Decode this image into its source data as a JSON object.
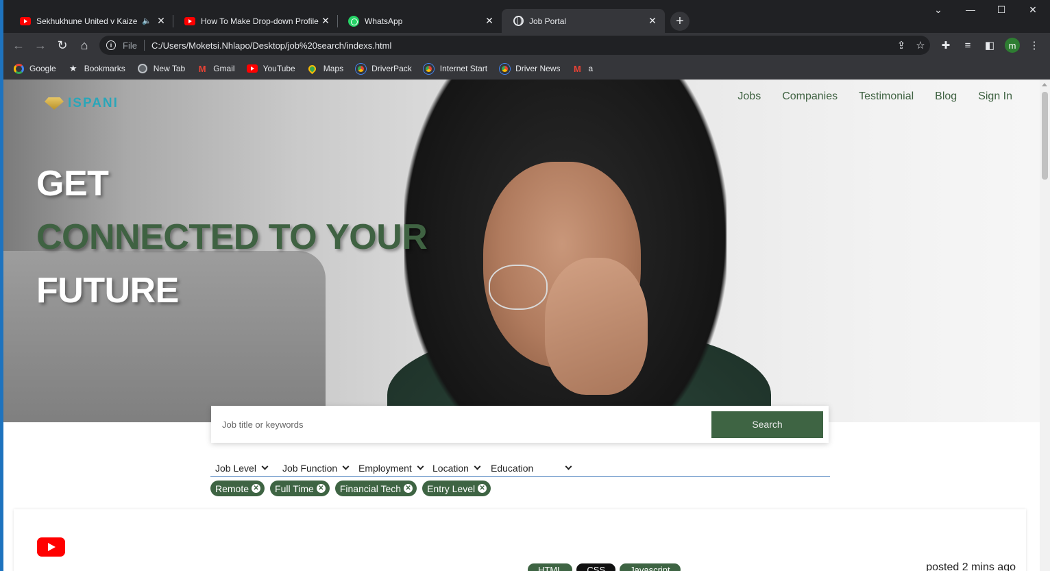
{
  "browser": {
    "tabs": [
      {
        "title": "Sekhukhune United v Kaizer",
        "icon": "youtube-icon",
        "audio": true
      },
      {
        "title": "How To Make Drop-down Profile",
        "icon": "youtube-icon"
      },
      {
        "title": "WhatsApp",
        "icon": "whatsapp-icon"
      },
      {
        "title": "Job Portal",
        "icon": "globe-icon",
        "active": true
      }
    ],
    "address": {
      "scheme": "File",
      "url": "C:/Users/Moketsi.Nhlapo/Desktop/job%20search/indexs.html"
    },
    "profile_initial": "m",
    "bookmarks": [
      {
        "label": "Google",
        "icon": "google-icon"
      },
      {
        "label": "Bookmarks",
        "icon": "star-icon"
      },
      {
        "label": "New Tab",
        "icon": "globe-icon"
      },
      {
        "label": "Gmail",
        "icon": "gmail-icon"
      },
      {
        "label": "YouTube",
        "icon": "youtube-icon"
      },
      {
        "label": "Maps",
        "icon": "maps-icon"
      },
      {
        "label": "DriverPack",
        "icon": "driverpack-icon"
      },
      {
        "label": "Internet Start",
        "icon": "globe-icon"
      },
      {
        "label": "Driver News",
        "icon": "driverpack-icon"
      },
      {
        "label": "a",
        "icon": "gmail-icon"
      }
    ]
  },
  "site": {
    "brand": "ISPANI",
    "nav": [
      "Jobs",
      "Companies",
      "Testimonial",
      "Blog",
      "Sign In"
    ],
    "hero": {
      "line1": "GET",
      "line2": "CONNECTED TO YOUR",
      "line3": "FUTURE"
    },
    "search": {
      "placeholder": "Job title or keywords",
      "button": "Search"
    },
    "filters": [
      "Job Level",
      "Job Function",
      "Employment",
      "Location",
      "Education"
    ],
    "chips": [
      "Remote",
      "Full Time",
      "Financial Tech",
      "Entry Level"
    ],
    "job": {
      "tags": [
        "HTML",
        "CSS",
        "Javascript"
      ],
      "posted": "posted 2 mins ago"
    }
  },
  "colors": {
    "accent": "#3e6443",
    "brand": "#2aa6b9",
    "hero_white": "#ffffff",
    "hero_green": "#3f6242"
  }
}
